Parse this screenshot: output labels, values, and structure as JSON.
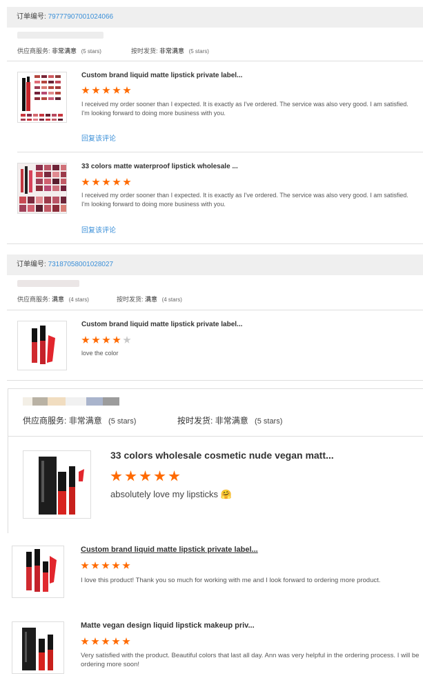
{
  "order1": {
    "label": "订单编号:",
    "number": "79777907001024066",
    "supplier_label": "供应商服务:",
    "supplier_value": "非常满意",
    "supplier_stars": "(5 stars)",
    "ship_label": "按时发货:",
    "ship_value": "非常满意",
    "ship_stars": "(5 stars)",
    "items": [
      {
        "title": "Custom brand liquid matte lipstick private label...",
        "stars": 5,
        "review": "I received my order sooner than I expected. It is exactly as I've ordered. The service was also very good. I am satisfied. I'm looking forward to doing more business with you.",
        "reply": "回复该评论"
      },
      {
        "title": "33 colors matte waterproof lipstick wholesale ...",
        "stars": 5,
        "review": "I received my order sooner than I expected. It is exactly as I've ordered. The service was also very good. I am satisfied. I'm looking forward to doing more business with you.",
        "reply": "回复该评论"
      }
    ]
  },
  "order2": {
    "label": "订单编号:",
    "number": "73187058001028027",
    "supplier_label": "供应商服务:",
    "supplier_value": "满意",
    "supplier_stars": "(4 stars)",
    "ship_label": "按时发货:",
    "ship_value": "满意",
    "ship_stars": "(4 stars)",
    "items": [
      {
        "title": "Custom brand liquid matte lipstick private label...",
        "stars": 4,
        "review": "love the color"
      }
    ]
  },
  "order3": {
    "supplier_label": "供应商服务:",
    "supplier_value": "非常满意",
    "supplier_stars": "(5 stars)",
    "ship_label": "按时发货:",
    "ship_value": "非常满意",
    "ship_stars": "(5 stars)",
    "item": {
      "title": "33 colors wholesale cosmetic nude vegan matt...",
      "stars": 5,
      "review": "absolutely love my lipsticks 🤗"
    }
  },
  "standalone": [
    {
      "title": "Custom brand liquid matte lipstick private label...",
      "stars": 5,
      "review": "I love this product! Thank you so much for working with me and I look forward to ordering more product."
    },
    {
      "title": "Matte vegan design liquid lipstick makeup priv...",
      "stars": 5,
      "review": "Very satisfied with the product. Beautiful colors that last all day. Ann was very helpful in the ordering process. I will be ordering more soon!"
    }
  ],
  "colors": {
    "star": "#ff6a00",
    "link": "#3a8fd8",
    "bar": "#efefef"
  }
}
